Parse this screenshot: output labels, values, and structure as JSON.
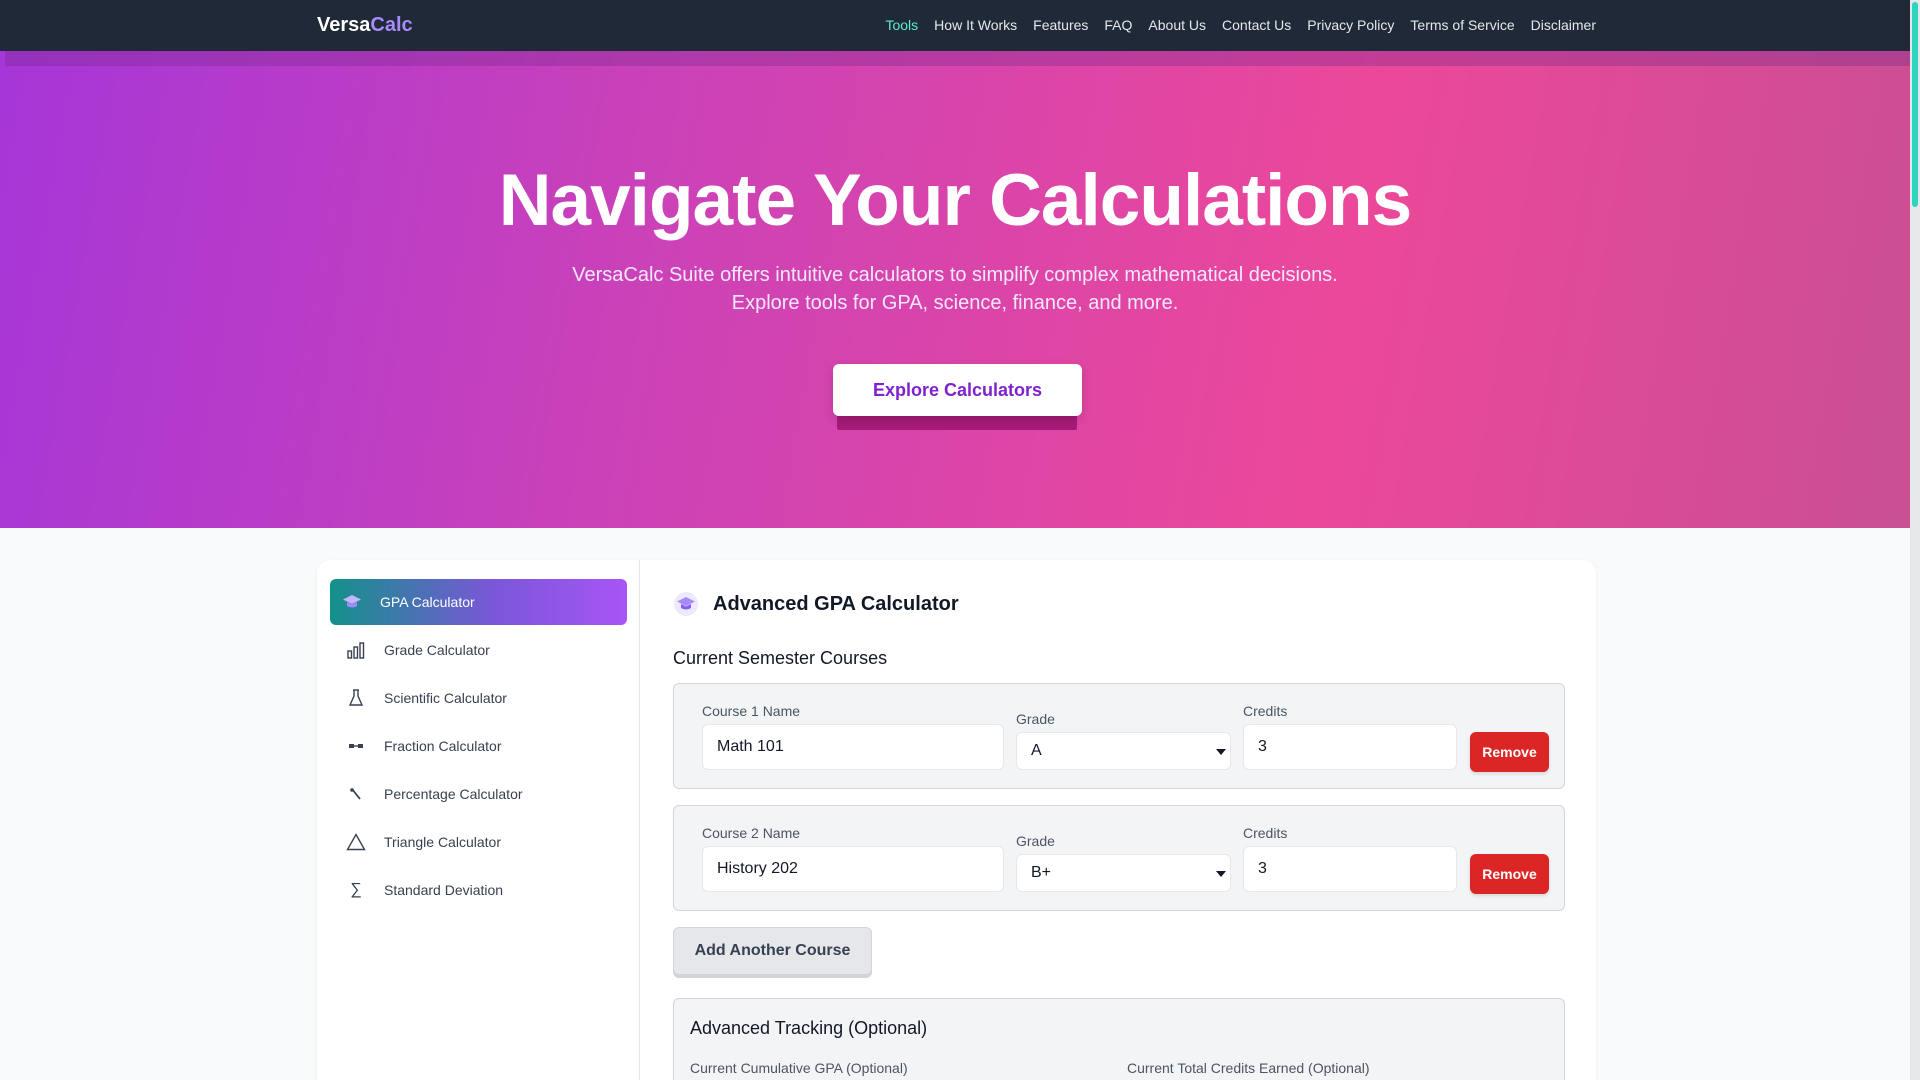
{
  "nav": {
    "brand_part1": "Versa",
    "brand_part2": "Calc",
    "links": [
      "Tools",
      "How It Works",
      "Features",
      "FAQ",
      "About Us",
      "Contact Us",
      "Privacy Policy",
      "Terms of Service",
      "Disclaimer"
    ],
    "active_link": "Tools"
  },
  "hero": {
    "title": "Navigate Your Calculations",
    "subtitle_line1": "VersaCalc Suite offers intuitive calculators to simplify complex mathematical decisions.",
    "subtitle_line2": "Explore tools for GPA, science, finance, and more.",
    "cta_label": "Explore Calculators"
  },
  "sidebar": {
    "items": [
      {
        "label": "GPA Calculator",
        "icon": "graduation-cap-icon",
        "active": true
      },
      {
        "label": "Grade Calculator",
        "icon": "bar-chart-icon",
        "active": false
      },
      {
        "label": "Scientific Calculator",
        "icon": "flask-icon",
        "active": false
      },
      {
        "label": "Fraction Calculator",
        "icon": "fraction-icon",
        "active": false
      },
      {
        "label": "Percentage Calculator",
        "icon": "percent-icon",
        "active": false
      },
      {
        "label": "Triangle Calculator",
        "icon": "triangle-icon",
        "active": false
      },
      {
        "label": "Standard Deviation",
        "icon": "sigma-icon",
        "active": false
      }
    ]
  },
  "calculator": {
    "title": "Advanced GPA Calculator",
    "section_title": "Current Semester Courses",
    "courses": [
      {
        "name_label": "Course 1 Name",
        "name_value": "Math 101",
        "grade_label": "Grade",
        "grade_value": "A",
        "credits_label": "Credits",
        "credits_value": "3",
        "remove_label": "Remove"
      },
      {
        "name_label": "Course 2 Name",
        "name_value": "History 202",
        "grade_label": "Grade",
        "grade_value": "B+",
        "credits_label": "Credits",
        "credits_value": "3",
        "remove_label": "Remove"
      }
    ],
    "add_course_label": "Add Another Course",
    "advanced": {
      "title": "Advanced Tracking (Optional)",
      "cumulative_gpa_label": "Current Cumulative GPA (Optional)",
      "total_credits_label": "Current Total Credits Earned (Optional)"
    }
  },
  "colors": {
    "navbar_bg": "#1f2937",
    "brand_accent": "#a78bfa",
    "active_link": "#5eead4",
    "hero_gradient_start": "#a636d8",
    "hero_gradient_end": "#ec4899",
    "cta_text": "#7e22ce",
    "remove_button": "#dc2626",
    "sidebar_active_start": "#13918a",
    "sidebar_active_end": "#a855f7"
  }
}
